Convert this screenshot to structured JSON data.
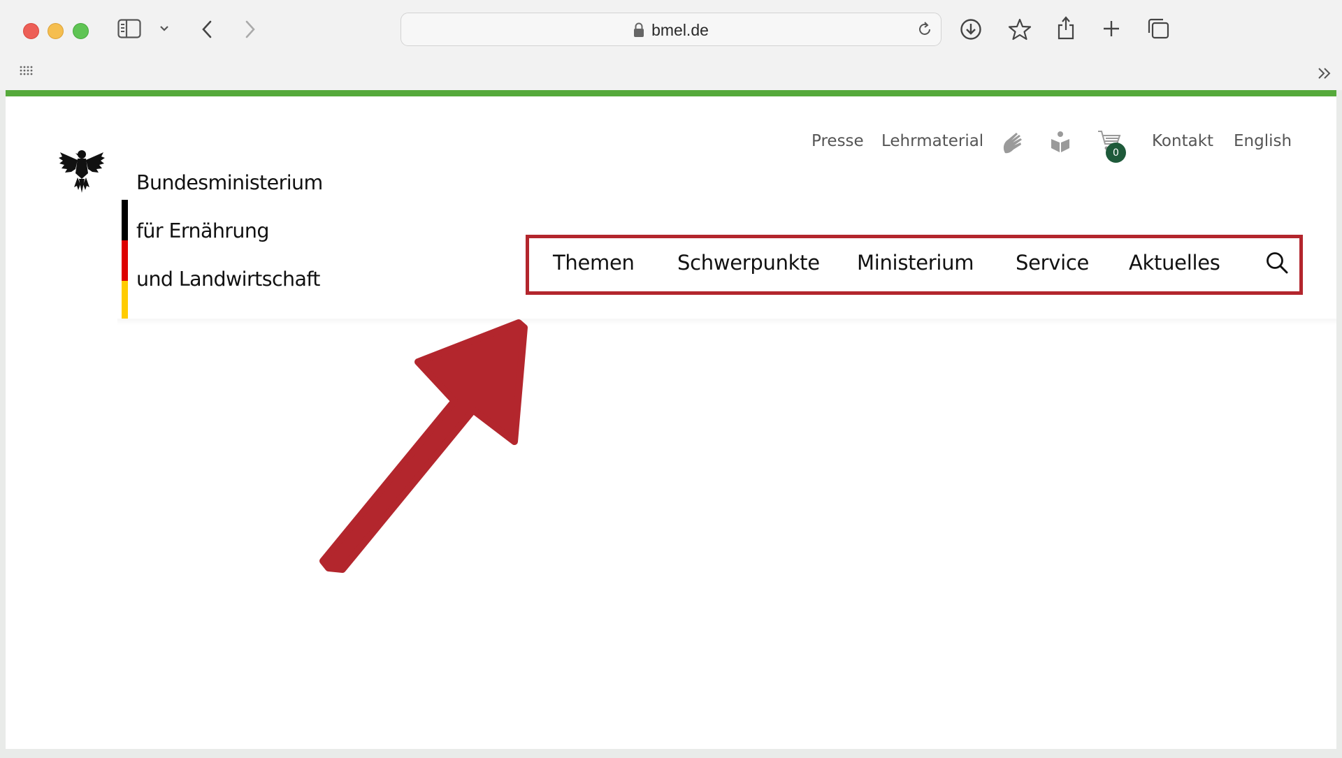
{
  "browser": {
    "url": "bmel.de"
  },
  "site": {
    "logo_lines": [
      "Bundesministerium",
      "für Ernährung",
      "und Landwirtschaft"
    ],
    "flag_colors": [
      "#000000",
      "#dd0000",
      "#ffcc00"
    ],
    "top_nav": {
      "presse": "Presse",
      "lehrmaterial": "Lehrmaterial",
      "cart_count": "0",
      "kontakt": "Kontakt",
      "english": "English"
    },
    "main_nav": [
      "Themen",
      "Schwerpunkte",
      "Ministerium",
      "Service",
      "Aktuelles"
    ]
  },
  "colors": {
    "accent_green": "#55a93b",
    "highlight_red": "#b3262d",
    "badge_green": "#1e5a3a"
  }
}
